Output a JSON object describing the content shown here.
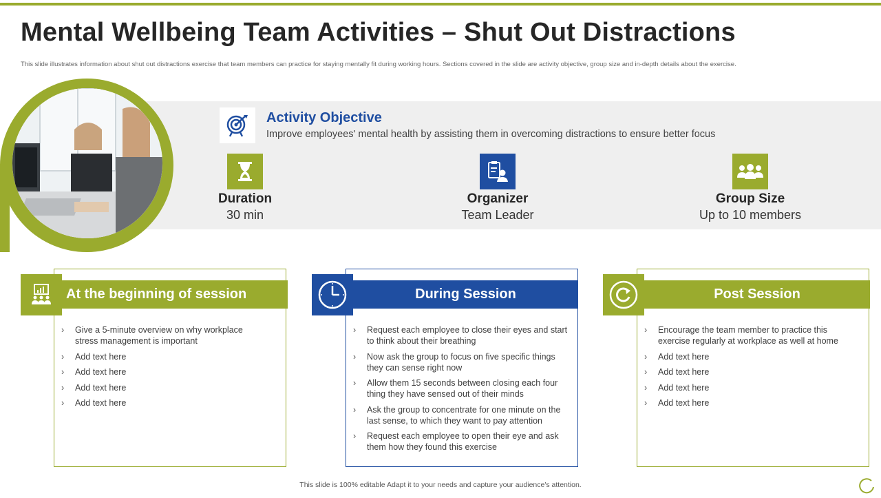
{
  "slide": {
    "title": "Mental Wellbeing Team Activities – Shut Out Distractions",
    "subtitle": "This slide illustrates information about shut out distractions exercise that team members  can practice for staying mentally  fit during working hours. Sections covered in the slide are activity objective, group size and in-depth details about the exercise.",
    "footer": "This slide is 100% editable Adapt it to your needs and capture your audience's attention."
  },
  "colors": {
    "accent_green": "#9aab2e",
    "accent_blue": "#1f4ea1",
    "band_gray": "#efefef"
  },
  "objective": {
    "icon": "target-icon",
    "title": "Activity Objective",
    "text": "Improve employees' mental health by assisting them in overcoming distractions to ensure better focus"
  },
  "stats": [
    {
      "icon": "hourglass-icon",
      "label": "Duration",
      "value": "30 min"
    },
    {
      "icon": "clipboard-person-icon",
      "label": "Organizer",
      "value": "Team Leader"
    },
    {
      "icon": "group-icon",
      "label": "Group Size",
      "value": "Up to 10 members"
    }
  ],
  "cards": [
    {
      "icon": "presentation-audience-icon",
      "title": "At the beginning of session",
      "items": [
        "Give a 5-minute overview  on why workplace stress management  is important",
        "Add text here",
        "Add text here",
        "Add text here",
        "Add text here"
      ]
    },
    {
      "icon": "clock-icon",
      "title": "During Session",
      "items": [
        "Request each employee to close their eyes and start to think about their breathing",
        "Now ask the group to focus on five  specific things they can sense right now",
        "Allow them 15 seconds between closing each four thing they have  sensed out of their minds",
        "Ask the group to concentrate for one minute on the last sense, to which they want to pay attention",
        "Request each employee to open their eye and ask them how they found this exercise"
      ]
    },
    {
      "icon": "refresh-icon",
      "title": "Post Session",
      "items": [
        "Encourage the team member to practice this exercise regularly  at workplace  as well at home",
        "Add text here",
        "Add text here",
        "Add text here",
        "Add text here"
      ]
    }
  ]
}
